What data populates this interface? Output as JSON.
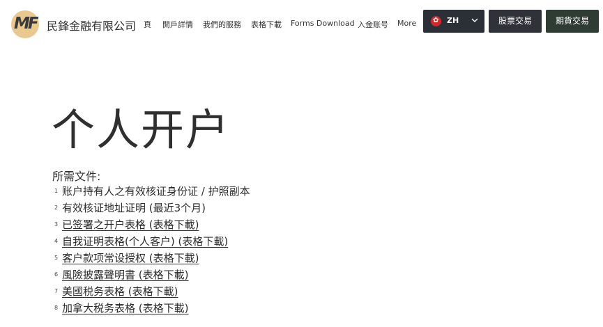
{
  "header": {
    "logo_text": "MF",
    "company_name": "民鋒金融有限公司",
    "nav": [
      {
        "label": "頁"
      },
      {
        "label": "開戶詳情"
      },
      {
        "label": "我們的服務"
      },
      {
        "label": "表格下載"
      },
      {
        "label": "Forms Download"
      },
      {
        "label": "入金账号"
      },
      {
        "label": "More"
      }
    ],
    "language": {
      "code": "ZH",
      "flag_icon": "hong-kong-flag-icon"
    },
    "stock_trading_label": "股票交易",
    "futures_trading_label": "期貨交易",
    "colors": {
      "lang_bg": "#2a3036",
      "stock_bg": "#30323a",
      "futures_bg": "#2e3c34",
      "logo_gold": "#e9c98e"
    }
  },
  "main": {
    "title": "个人开户",
    "required_label": "所需文件:",
    "documents": [
      {
        "num": "1",
        "text": "账户持有人之有效核证身份证 / 护照副本",
        "link": false
      },
      {
        "num": "2",
        "text": "有效核证地址证明 (最近3个月)",
        "link": false
      },
      {
        "num": "3",
        "text": "已签署之开户表格 (表格下載)",
        "link": true
      },
      {
        "num": "4",
        "text": "自我证明表格(个人客户) (表格下載)",
        "link": true
      },
      {
        "num": "5",
        "text": "客户款项常设授权 (表格下載)",
        "link": true
      },
      {
        "num": "6",
        "text": "風險披露聲明書 (表格下載)",
        "link": true
      },
      {
        "num": "7",
        "text": "美國税务表格 (表格下載)",
        "link": true
      },
      {
        "num": "8",
        "text": "加拿大税务表格 (表格下載)",
        "link": true
      }
    ]
  }
}
